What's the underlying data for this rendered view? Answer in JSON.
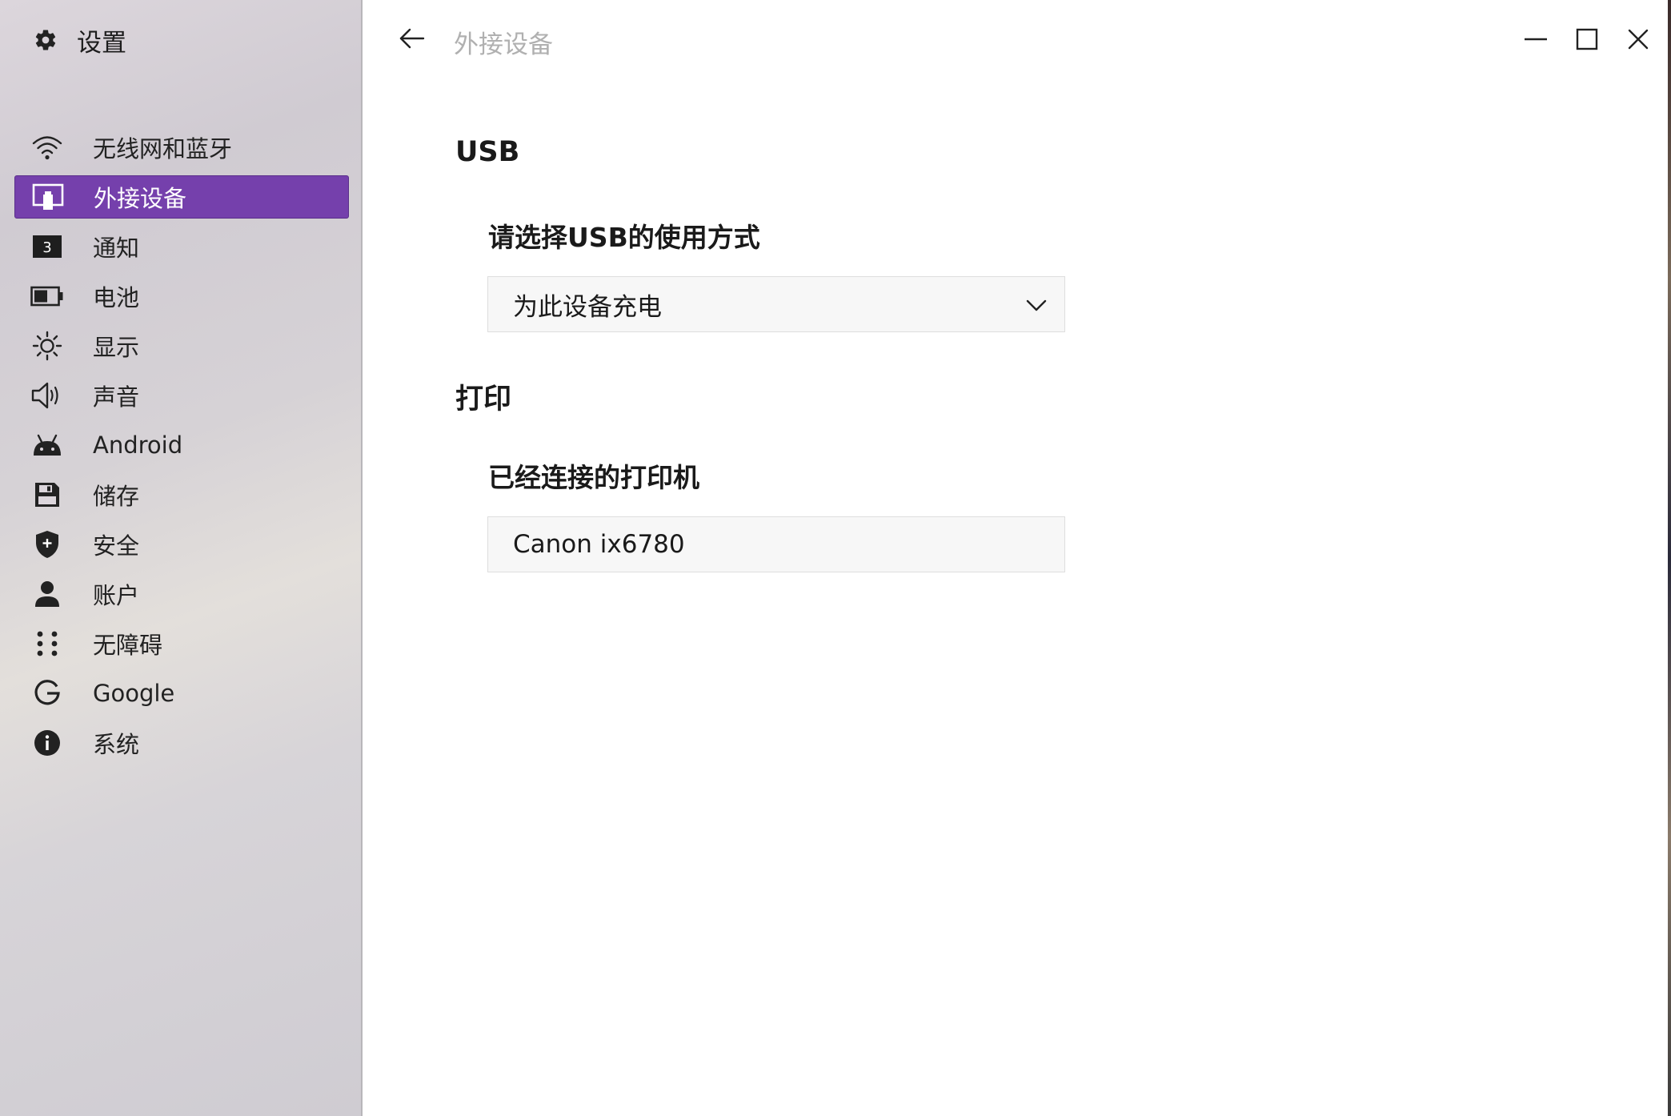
{
  "app": {
    "title": "设置",
    "icon": "gear-icon"
  },
  "sidebar": {
    "items": [
      {
        "label": "无线网和蓝牙",
        "icon": "wifi-icon",
        "selected": false
      },
      {
        "label": "外接设备",
        "icon": "connected-devices-icon",
        "selected": true
      },
      {
        "label": "通知",
        "icon": "notification-badge-icon",
        "badge": "3",
        "selected": false
      },
      {
        "label": "电池",
        "icon": "battery-icon",
        "selected": false
      },
      {
        "label": "显示",
        "icon": "brightness-icon",
        "selected": false
      },
      {
        "label": "声音",
        "icon": "speaker-icon",
        "selected": false
      },
      {
        "label": "Android",
        "icon": "android-icon",
        "selected": false
      },
      {
        "label": "储存",
        "icon": "storage-icon",
        "selected": false
      },
      {
        "label": "安全",
        "icon": "shield-icon",
        "selected": false
      },
      {
        "label": "账户",
        "icon": "account-icon",
        "selected": false
      },
      {
        "label": "无障碍",
        "icon": "accessibility-icon",
        "selected": false
      },
      {
        "label": "Google",
        "icon": "google-icon",
        "selected": false
      },
      {
        "label": "系统",
        "icon": "info-icon",
        "selected": false
      }
    ]
  },
  "header": {
    "page_title": "外接设备",
    "back_icon": "back-arrow-icon",
    "window_controls": [
      "minimize-icon",
      "maximize-icon",
      "close-icon"
    ]
  },
  "content": {
    "usb": {
      "section_title": "USB",
      "field_label": "请选择USB的使用方式",
      "selected_option": "为此设备充电"
    },
    "print": {
      "section_title": "打印",
      "field_label": "已经连接的打印机",
      "printer_name": "Canon ix6780"
    }
  },
  "colors": {
    "accent": "#7540ac",
    "title_muted": "#b0b0b0"
  }
}
